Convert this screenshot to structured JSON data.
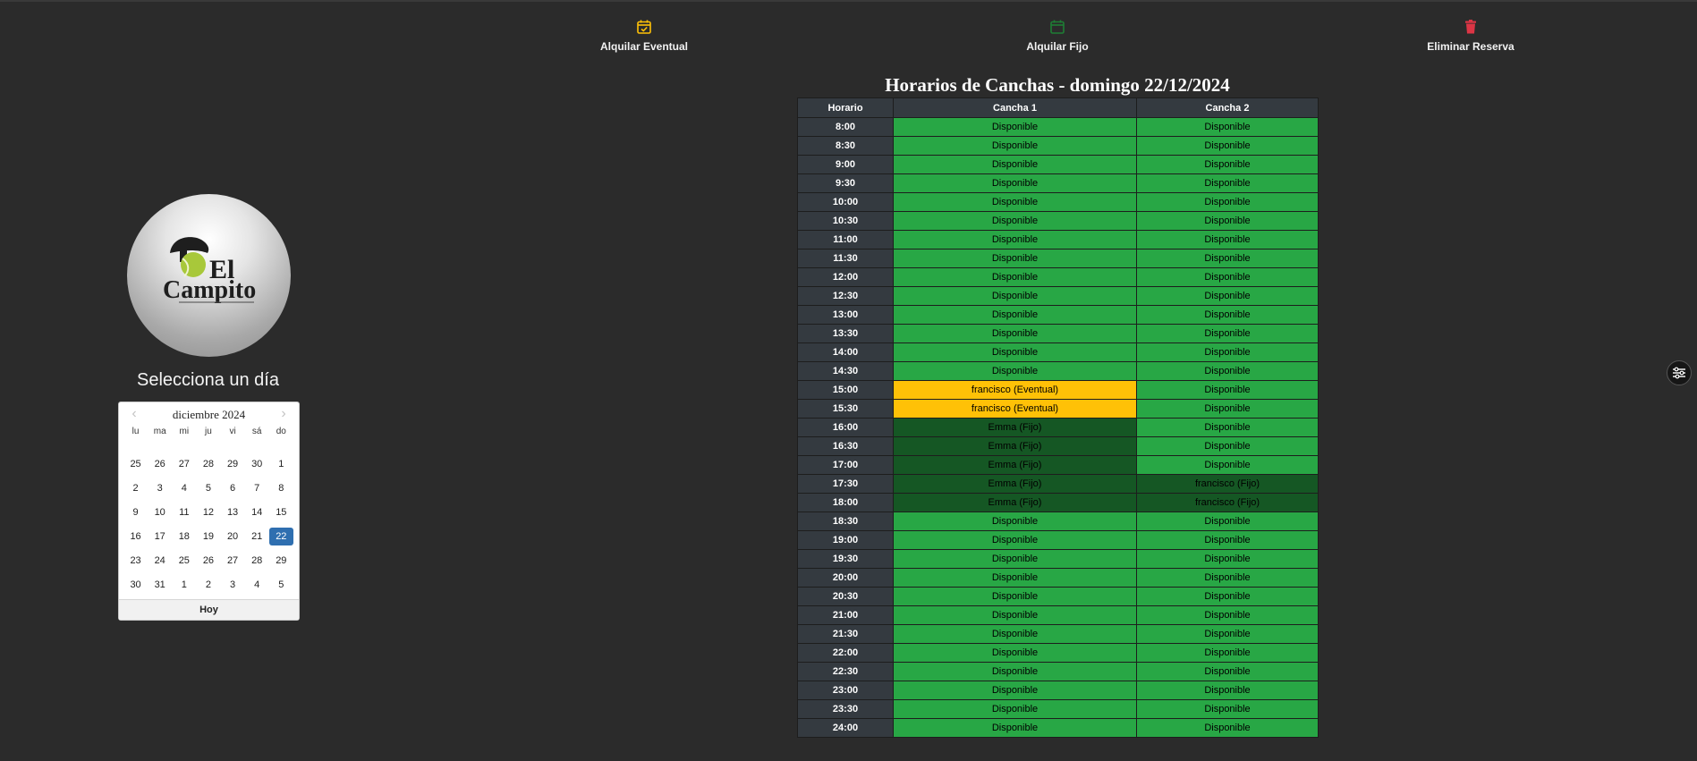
{
  "actions": {
    "eventual": "Alquilar Eventual",
    "fijo": "Alquilar Fijo",
    "eliminar": "Eliminar Reserva"
  },
  "colors": {
    "eventual_icon": "#ffc107",
    "fijo_icon": "#1e7e34",
    "eliminar_icon": "#dc3545",
    "available": "#28a745",
    "eventual": "#ffc107",
    "fixed": "#155724",
    "header": "#343a40",
    "selected_day": "#2f6fb0"
  },
  "logo": {
    "line1": "El",
    "line2": "Campito"
  },
  "select_title": "Selecciona un día",
  "calendar": {
    "month": "diciembre 2024",
    "weekdays": [
      "lu",
      "ma",
      "mi",
      "ju",
      "vi",
      "sá",
      "do"
    ],
    "weeks": [
      [
        "25",
        "26",
        "27",
        "28",
        "29",
        "30",
        "1"
      ],
      [
        "2",
        "3",
        "4",
        "5",
        "6",
        "7",
        "8"
      ],
      [
        "9",
        "10",
        "11",
        "12",
        "13",
        "14",
        "15"
      ],
      [
        "16",
        "17",
        "18",
        "19",
        "20",
        "21",
        "22"
      ],
      [
        "23",
        "24",
        "25",
        "26",
        "27",
        "28",
        "29"
      ],
      [
        "30",
        "31",
        "1",
        "2",
        "3",
        "4",
        "5"
      ]
    ],
    "selected": "22",
    "today_label": "Hoy"
  },
  "schedule": {
    "title": "Horarios de Canchas - domingo 22/12/2024",
    "headers": [
      "Horario",
      "Cancha 1",
      "Cancha 2"
    ],
    "rows": [
      {
        "time": "8:00",
        "c1": "Disponible",
        "c1_type": "avail",
        "c2": "Disponible",
        "c2_type": "avail"
      },
      {
        "time": "8:30",
        "c1": "Disponible",
        "c1_type": "avail",
        "c2": "Disponible",
        "c2_type": "avail"
      },
      {
        "time": "9:00",
        "c1": "Disponible",
        "c1_type": "avail",
        "c2": "Disponible",
        "c2_type": "avail"
      },
      {
        "time": "9:30",
        "c1": "Disponible",
        "c1_type": "avail",
        "c2": "Disponible",
        "c2_type": "avail"
      },
      {
        "time": "10:00",
        "c1": "Disponible",
        "c1_type": "avail",
        "c2": "Disponible",
        "c2_type": "avail"
      },
      {
        "time": "10:30",
        "c1": "Disponible",
        "c1_type": "avail",
        "c2": "Disponible",
        "c2_type": "avail"
      },
      {
        "time": "11:00",
        "c1": "Disponible",
        "c1_type": "avail",
        "c2": "Disponible",
        "c2_type": "avail"
      },
      {
        "time": "11:30",
        "c1": "Disponible",
        "c1_type": "avail",
        "c2": "Disponible",
        "c2_type": "avail"
      },
      {
        "time": "12:00",
        "c1": "Disponible",
        "c1_type": "avail",
        "c2": "Disponible",
        "c2_type": "avail"
      },
      {
        "time": "12:30",
        "c1": "Disponible",
        "c1_type": "avail",
        "c2": "Disponible",
        "c2_type": "avail"
      },
      {
        "time": "13:00",
        "c1": "Disponible",
        "c1_type": "avail",
        "c2": "Disponible",
        "c2_type": "avail"
      },
      {
        "time": "13:30",
        "c1": "Disponible",
        "c1_type": "avail",
        "c2": "Disponible",
        "c2_type": "avail"
      },
      {
        "time": "14:00",
        "c1": "Disponible",
        "c1_type": "avail",
        "c2": "Disponible",
        "c2_type": "avail"
      },
      {
        "time": "14:30",
        "c1": "Disponible",
        "c1_type": "avail",
        "c2": "Disponible",
        "c2_type": "avail"
      },
      {
        "time": "15:00",
        "c1": "francisco (Eventual)",
        "c1_type": "eventual",
        "c2": "Disponible",
        "c2_type": "avail"
      },
      {
        "time": "15:30",
        "c1": "francisco (Eventual)",
        "c1_type": "eventual",
        "c2": "Disponible",
        "c2_type": "avail"
      },
      {
        "time": "16:00",
        "c1": "Emma (Fijo)",
        "c1_type": "fijo",
        "c2": "Disponible",
        "c2_type": "avail"
      },
      {
        "time": "16:30",
        "c1": "Emma (Fijo)",
        "c1_type": "fijo",
        "c2": "Disponible",
        "c2_type": "avail"
      },
      {
        "time": "17:00",
        "c1": "Emma (Fijo)",
        "c1_type": "fijo",
        "c2": "Disponible",
        "c2_type": "avail"
      },
      {
        "time": "17:30",
        "c1": "Emma (Fijo)",
        "c1_type": "fijo",
        "c2": "francisco (Fijo)",
        "c2_type": "fijo"
      },
      {
        "time": "18:00",
        "c1": "Emma (Fijo)",
        "c1_type": "fijo",
        "c2": "francisco (Fijo)",
        "c2_type": "fijo"
      },
      {
        "time": "18:30",
        "c1": "Disponible",
        "c1_type": "avail",
        "c2": "Disponible",
        "c2_type": "avail"
      },
      {
        "time": "19:00",
        "c1": "Disponible",
        "c1_type": "avail",
        "c2": "Disponible",
        "c2_type": "avail"
      },
      {
        "time": "19:30",
        "c1": "Disponible",
        "c1_type": "avail",
        "c2": "Disponible",
        "c2_type": "avail"
      },
      {
        "time": "20:00",
        "c1": "Disponible",
        "c1_type": "avail",
        "c2": "Disponible",
        "c2_type": "avail"
      },
      {
        "time": "20:30",
        "c1": "Disponible",
        "c1_type": "avail",
        "c2": "Disponible",
        "c2_type": "avail"
      },
      {
        "time": "21:00",
        "c1": "Disponible",
        "c1_type": "avail",
        "c2": "Disponible",
        "c2_type": "avail"
      },
      {
        "time": "21:30",
        "c1": "Disponible",
        "c1_type": "avail",
        "c2": "Disponible",
        "c2_type": "avail"
      },
      {
        "time": "22:00",
        "c1": "Disponible",
        "c1_type": "avail",
        "c2": "Disponible",
        "c2_type": "avail"
      },
      {
        "time": "22:30",
        "c1": "Disponible",
        "c1_type": "avail",
        "c2": "Disponible",
        "c2_type": "avail"
      },
      {
        "time": "23:00",
        "c1": "Disponible",
        "c1_type": "avail",
        "c2": "Disponible",
        "c2_type": "avail"
      },
      {
        "time": "23:30",
        "c1": "Disponible",
        "c1_type": "avail",
        "c2": "Disponible",
        "c2_type": "avail"
      },
      {
        "time": "24:00",
        "c1": "Disponible",
        "c1_type": "avail",
        "c2": "Disponible",
        "c2_type": "avail"
      }
    ]
  }
}
